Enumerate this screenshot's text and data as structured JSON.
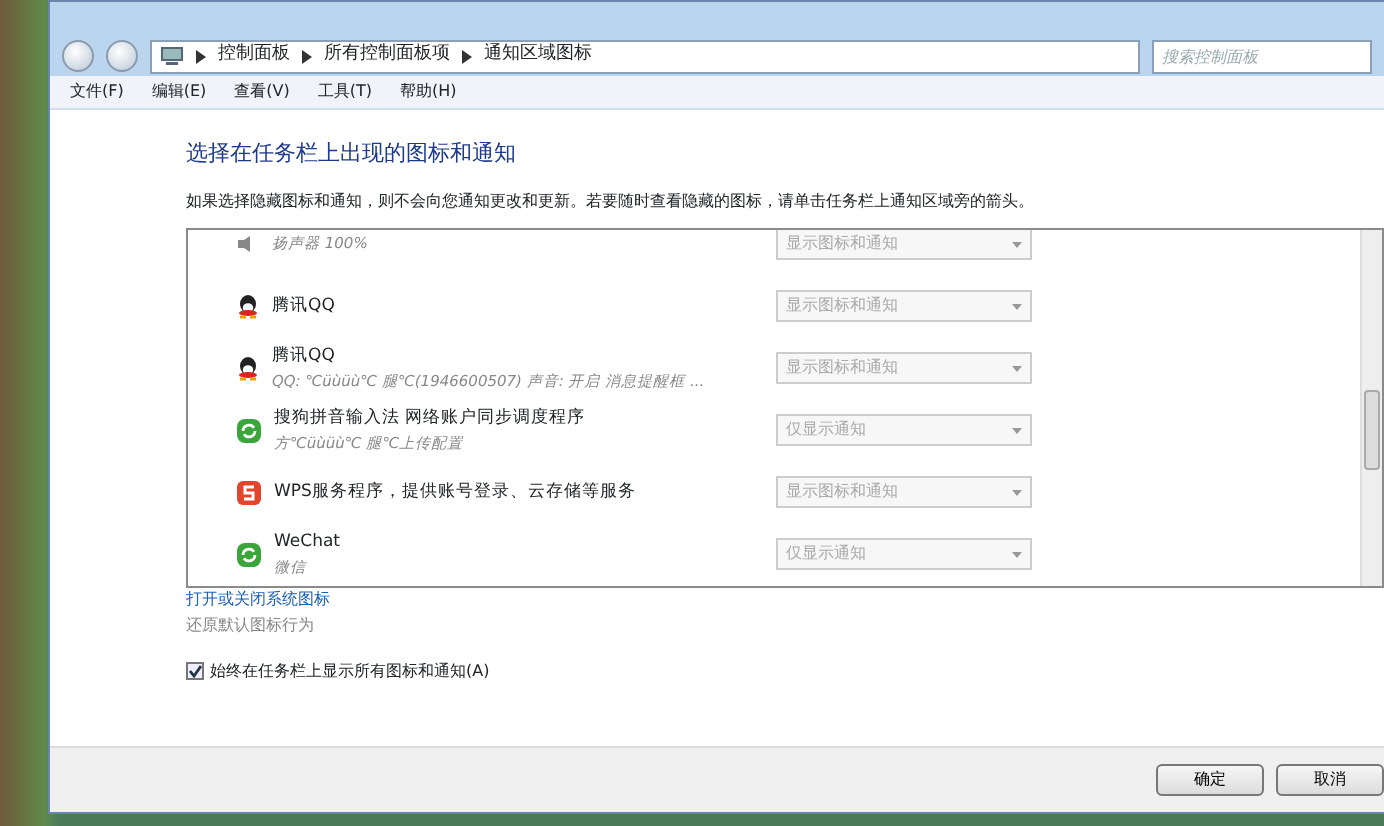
{
  "address_bar": {
    "crumbs": [
      "控制面板",
      "所有控制面板项",
      "通知区域图标"
    ]
  },
  "search": {
    "placeholder": "搜索控制面板"
  },
  "menu": [
    "文件(F)",
    "编辑(E)",
    "查看(V)",
    "工具(T)",
    "帮助(H)"
  ],
  "heading": "选择在任务栏上出现的图标和通知",
  "description": "如果选择隐藏图标和通知，则不会向您通知更改和更新。若要随时查看隐藏的图标，请单击任务栏上通知区域旁的箭头。",
  "icons_list": [
    {
      "kind": "speaker",
      "detail": "扬声器 100%",
      "behavior": "显示图标和通知"
    },
    {
      "kind": "qq",
      "name": "腾讯QQ",
      "behavior": "显示图标和通知"
    },
    {
      "kind": "qq",
      "name": "腾讯QQ",
      "detail": "QQ: ℃üùüù℃  腿℃(1946600507)  声音: 开启  消息提醒框 ...",
      "behavior": "显示图标和通知"
    },
    {
      "kind": "sync",
      "name": "搜狗拼音输入法 网络账户同步调度程序",
      "detail": "方℃üùüù℃  腿℃上传配置",
      "behavior": "仅显示通知"
    },
    {
      "kind": "wps",
      "name": "WPS服务程序，提供账号登录、云存储等服务",
      "behavior": "显示图标和通知"
    },
    {
      "kind": "sync",
      "name": "WeChat",
      "detail": "微信",
      "behavior": "仅显示通知"
    }
  ],
  "system_icons_link": "打开或关闭系统图标",
  "restore_link": "还原默认图标行为",
  "always_show": {
    "label": "始终在任务栏上显示所有图标和通知(A)",
    "checked": true
  },
  "buttons": [
    "确定",
    "取消"
  ]
}
